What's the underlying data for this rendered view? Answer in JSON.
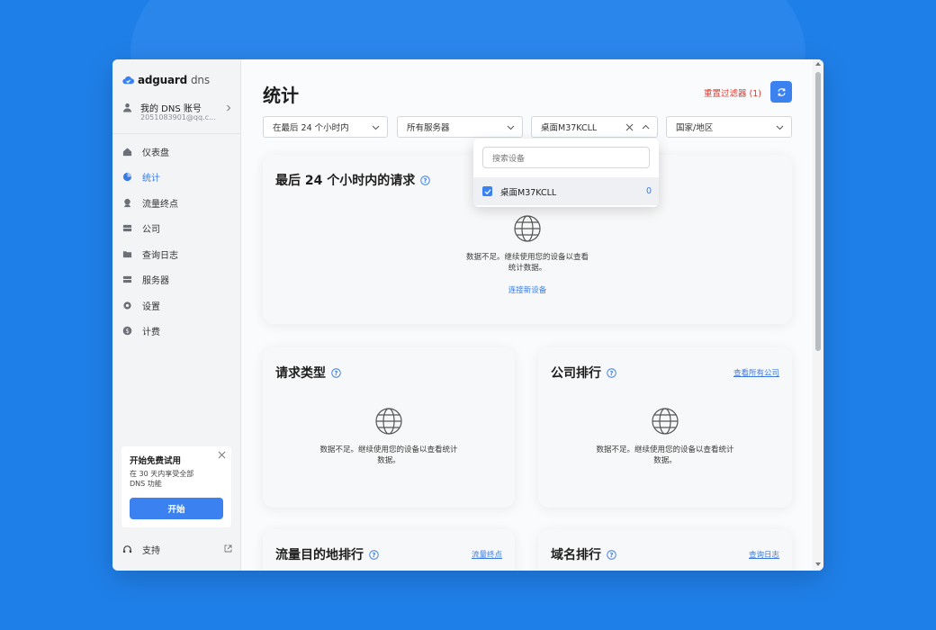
{
  "app": {
    "brand": "adguard",
    "brand_suffix": "dns"
  },
  "account": {
    "label": "我的 DNS 账号",
    "email": "2051083901@qq.c..."
  },
  "sidebar": {
    "items": [
      {
        "label": "仪表盘",
        "icon": "home-icon",
        "active": false
      },
      {
        "label": "统计",
        "icon": "pie-chart-icon",
        "active": true
      },
      {
        "label": "流量终点",
        "icon": "pin-icon",
        "active": false
      },
      {
        "label": "公司",
        "icon": "company-icon",
        "active": false
      },
      {
        "label": "查询日志",
        "icon": "folder-icon",
        "active": false
      },
      {
        "label": "服务器",
        "icon": "server-icon",
        "active": false
      },
      {
        "label": "设置",
        "icon": "gear-icon",
        "active": false
      },
      {
        "label": "计费",
        "icon": "dollar-icon",
        "active": false
      }
    ]
  },
  "trial": {
    "title": "开始免费试用",
    "desc": "在 30 天内享受全部 DNS 功能",
    "button": "开始"
  },
  "support": {
    "label": "支持"
  },
  "main": {
    "title": "统计",
    "reset_filters": "重置过滤器 (1)",
    "filters": {
      "time": "在最后 24 个小时内",
      "server": "所有服务器",
      "device": "桌面M37KCLL",
      "country": "国家/地区"
    }
  },
  "dropdown": {
    "search_placeholder": "搜索设备",
    "items": [
      {
        "label": "桌面M37KCLL",
        "count": "0",
        "checked": true
      }
    ]
  },
  "cards": {
    "requests": {
      "title": "最后 24 个小时内的请求",
      "empty_text": "数据不足。继续使用您的设备以查看统计数据。",
      "link": "连接新设备"
    },
    "request_types": {
      "title": "请求类型",
      "empty_text": "数据不足。继续使用您的设备以查看统计数据。"
    },
    "company_rank": {
      "title": "公司排行",
      "link": "查看所有公司",
      "empty_text": "数据不足。继续使用您的设备以查看统计数据。"
    },
    "traffic_dest": {
      "title": "流量目的地排行",
      "link": "流量终点"
    },
    "domain_rank": {
      "title": "域名排行",
      "link": "查询日志"
    }
  },
  "colors": {
    "accent": "#3b82f0",
    "danger": "#e3362c",
    "background": "#1f7fe8"
  }
}
